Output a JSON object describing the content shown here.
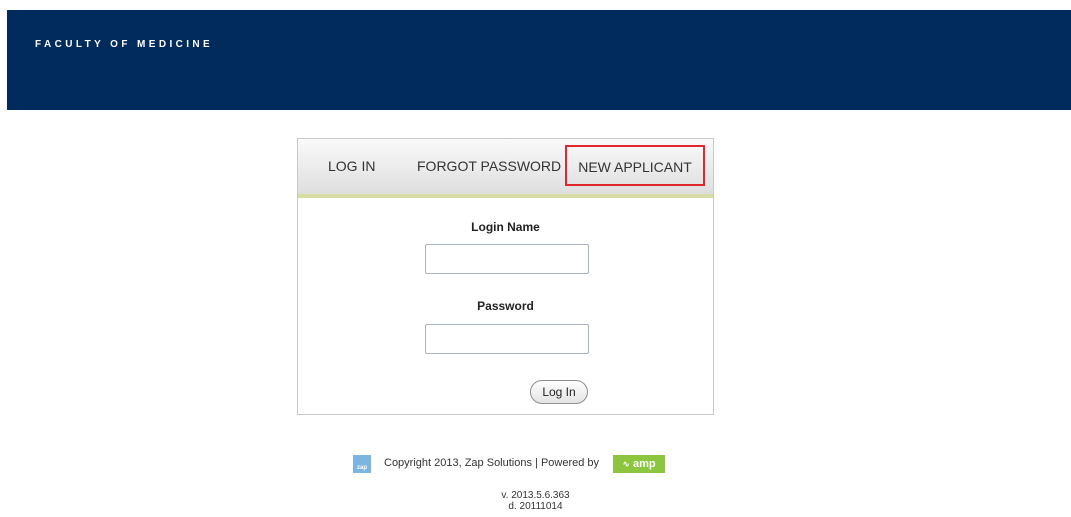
{
  "header": {
    "title": "FACULTY OF MEDICINE"
  },
  "tabs": {
    "login": "LOG IN",
    "forgot": "FORGOT PASSWORD",
    "new_applicant": "NEW APPLICANT"
  },
  "form": {
    "login_name_label": "Login Name",
    "login_name_value": "",
    "password_label": "Password",
    "password_value": "",
    "submit_label": "Log In"
  },
  "footer": {
    "zap_logo_text": "zap",
    "copyright": "Copyright 2013, Zap Solutions | Powered by",
    "amp_logo_text": "amp",
    "version": "v. 2013.5.6.363",
    "build_date": "d. 20111014"
  },
  "colors": {
    "header_bg": "#002b5c",
    "highlight_border": "#e0262e",
    "tab_underline": "#d6dca4",
    "amp_green": "#8cc63f",
    "zap_blue": "#7ab6e0"
  }
}
